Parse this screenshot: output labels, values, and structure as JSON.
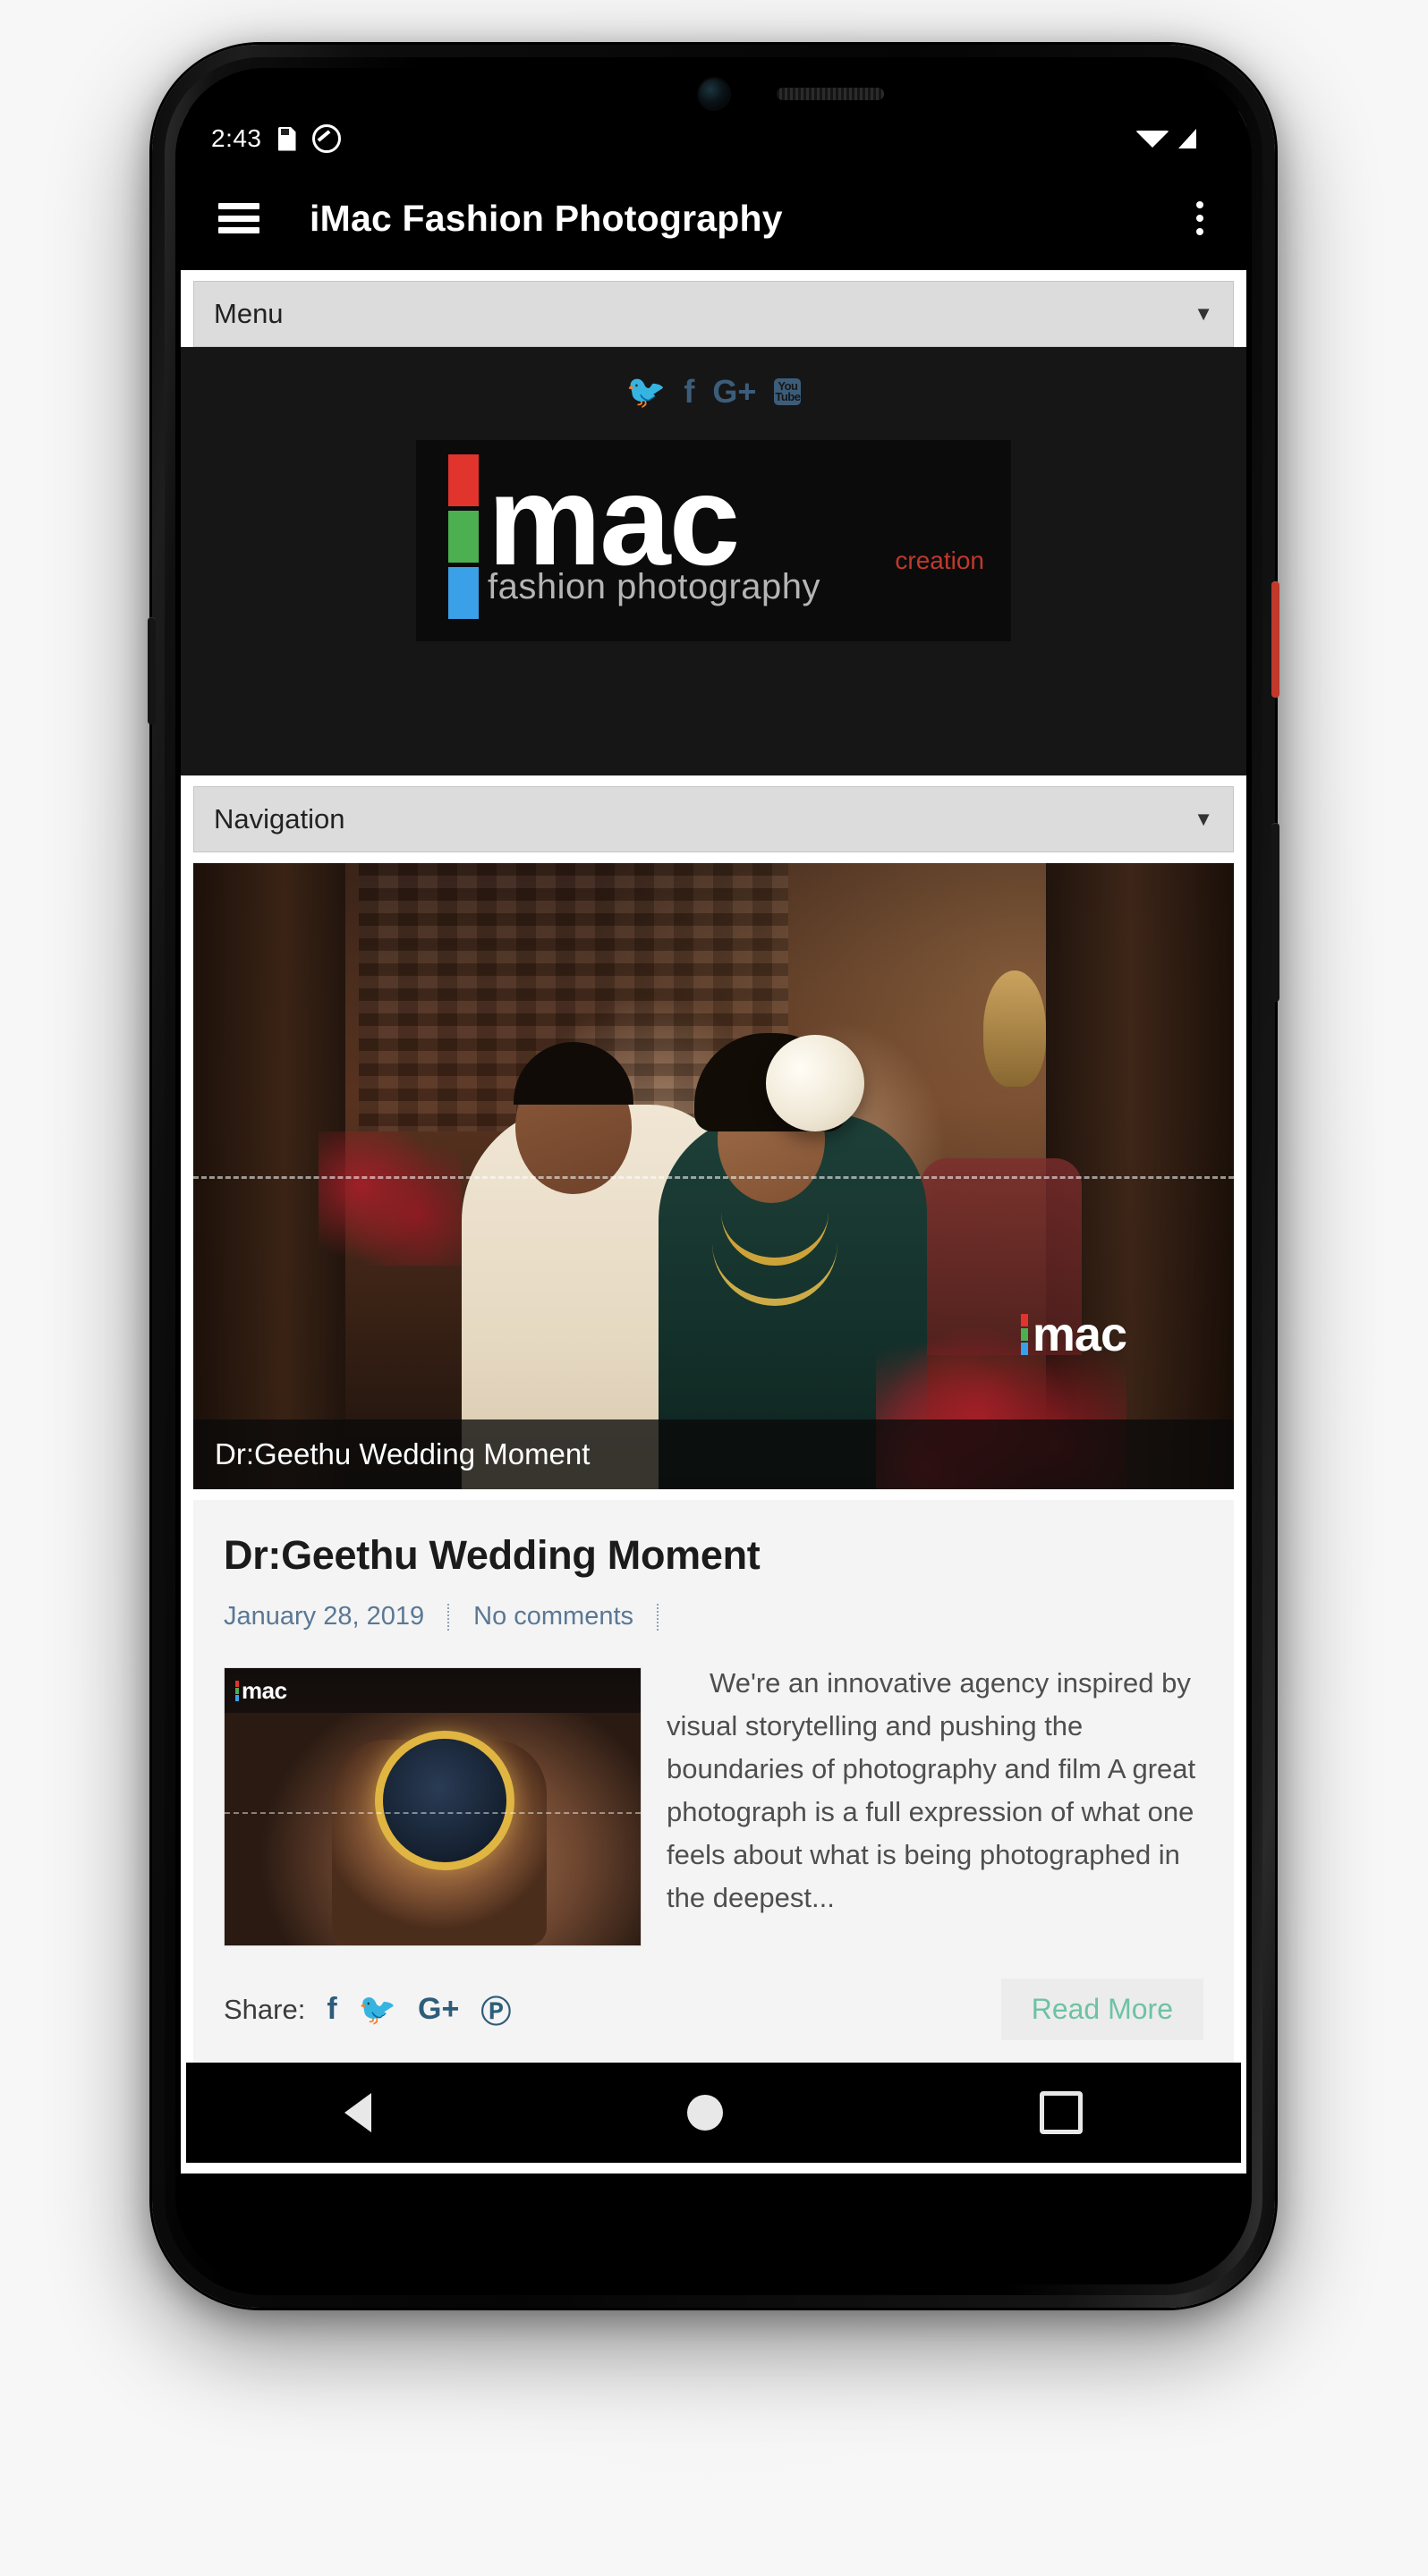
{
  "status_bar": {
    "time": "2:43",
    "icons_left": [
      "sd-card-icon",
      "do-not-disturb-icon"
    ],
    "icons_right": [
      "wifi-icon",
      "signal-icon"
    ]
  },
  "app_bar": {
    "menu_icon": "hamburger-icon",
    "title": "iMac Fashion Photography",
    "overflow_icon": "kebab-menu-icon"
  },
  "site": {
    "menu_dropdown": {
      "label": "Menu",
      "caret": "▼"
    },
    "navigation_dropdown": {
      "label": "Navigation",
      "caret": "▼"
    },
    "social_links": [
      {
        "name": "twitter",
        "glyph": "🐦"
      },
      {
        "name": "facebook",
        "glyph": "f"
      },
      {
        "name": "google-plus",
        "glyph": "G+"
      },
      {
        "name": "youtube",
        "glyph": "You Tube"
      }
    ],
    "logo": {
      "word": "mac",
      "tagline": "fashion photography",
      "badge": "creation",
      "bar_colors": [
        "#e0342d",
        "#4caf50",
        "#3aa0e8"
      ]
    }
  },
  "featured": {
    "caption": "Dr:Geethu Wedding Moment",
    "watermark": "mac"
  },
  "post": {
    "title": "Dr:Geethu Wedding Moment",
    "date": "January 28, 2019",
    "comments": "No comments",
    "thumbnail_watermark": "mac",
    "body": "We're an innovative agency inspired by visual storytelling and pushing the boundaries of photography and film A great photograph is a full expression of what one feels about what is being photographed in the deepest...",
    "share_label": "Share:",
    "share_icons": [
      {
        "name": "facebook",
        "glyph": "f"
      },
      {
        "name": "twitter",
        "glyph": "🐦"
      },
      {
        "name": "google-plus",
        "glyph": "G+"
      },
      {
        "name": "pinterest",
        "glyph": "𝓟"
      }
    ],
    "read_more": "Read More"
  },
  "nav_bar": {
    "back": "back-icon",
    "home": "home-icon",
    "recents": "recents-icon"
  },
  "colors": {
    "app_bar_bg": "#000000",
    "dropdown_bg": "#dcdcdc",
    "dark_band": "#161616",
    "meta_link": "#5a7895",
    "read_more_text": "#6ec2a4",
    "social_blue": "#3c5d7a"
  }
}
